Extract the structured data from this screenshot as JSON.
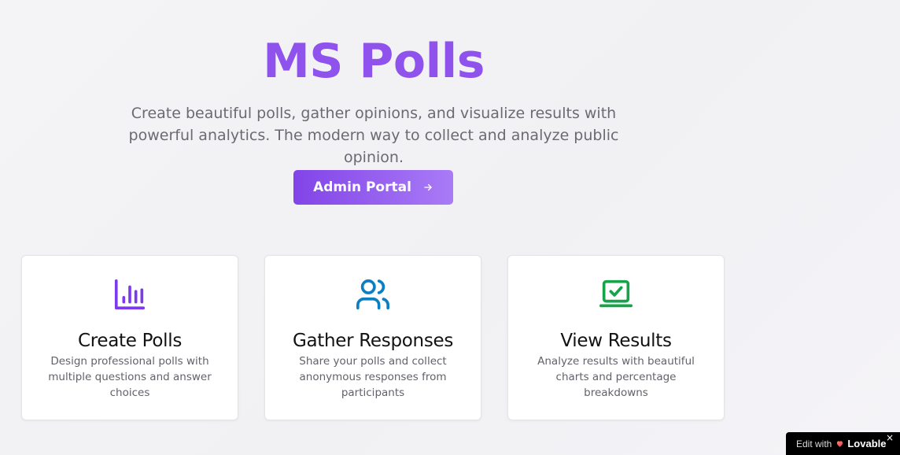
{
  "hero": {
    "title": "MS Polls",
    "subtitle": "Create beautiful polls, gather opinions, and visualize results with powerful analytics. The modern way to collect and analyze public opinion.",
    "cta_label": "Admin Portal",
    "cta_icon": "arrow-right-icon"
  },
  "features": [
    {
      "title": "Create Polls",
      "description": "Design professional polls with multiple questions and answer choices",
      "icon": "bar-chart-icon",
      "icon_color": "#7c3aed"
    },
    {
      "title": "Gather Responses",
      "description": "Share your polls and collect anonymous responses from participants",
      "icon": "users-icon",
      "icon_color": "#0b7fc2"
    },
    {
      "title": "View Results",
      "description": "Analyze results with beautiful charts and percentage breakdowns",
      "icon": "laptop-check-icon",
      "icon_color": "#16a34a"
    }
  ],
  "badge": {
    "edit_text": "Edit with",
    "brand": "Lovable",
    "close_label": "×"
  },
  "colors": {
    "accent": "#8f52ec",
    "button_gradient_start": "#8244e8",
    "button_gradient_end": "#a97bf6"
  }
}
